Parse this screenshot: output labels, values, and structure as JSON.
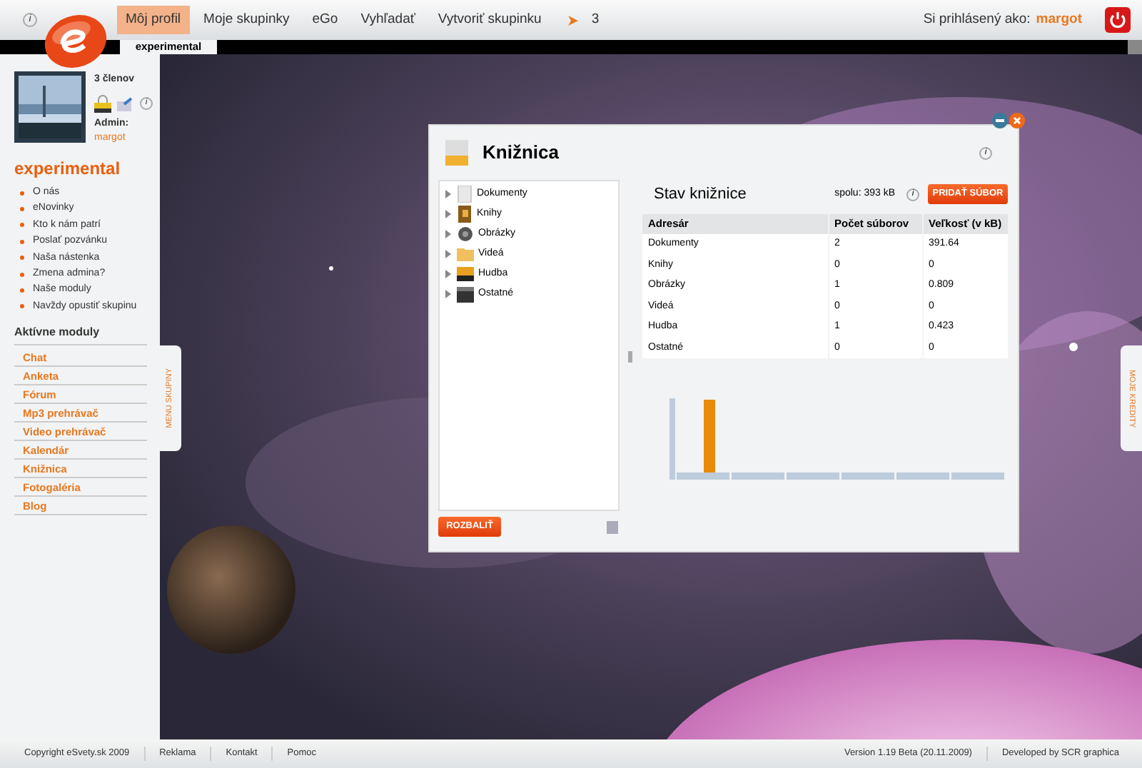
{
  "topbar": {
    "info": "i",
    "nav": [
      {
        "label": "Môj profil",
        "selected": true
      },
      {
        "label": "Moje skupinky",
        "selected": false
      },
      {
        "label": "eGo",
        "selected": false
      },
      {
        "label": "Vyhľadať",
        "selected": false
      },
      {
        "label": "Vytvoriť skupinku",
        "selected": false
      }
    ],
    "notifications": "3",
    "logged_label": "Si prihlásený ako:",
    "user": "margot"
  },
  "group_tab": "experimental",
  "sidebar": {
    "members": "3 členov",
    "info": "i",
    "admin_label": "Admin:",
    "admin": "margot",
    "title": "experimental",
    "links": [
      "O nás",
      "eNovinky",
      "Kto k nám patrí",
      "Poslať pozvánku",
      "Naša nástenka",
      "Zmena admina?",
      "Naše moduly",
      "Navždy opustiť skupinu"
    ],
    "modules_title": "Aktívne moduly",
    "modules": [
      "Chat",
      "Anketa",
      "Fórum",
      "Mp3 prehrávač",
      "Video prehrávač",
      "Kalendár",
      "Knižnica",
      "Fotogaléria",
      "Blog"
    ]
  },
  "left_tab": "MENU SKUPINY",
  "right_tab": "MOJE KREDITY",
  "dialog": {
    "title": "Knižnica",
    "info": "i",
    "tree": [
      {
        "label": "Dokumenty",
        "kind": "doc"
      },
      {
        "label": "Knihy",
        "kind": "book"
      },
      {
        "label": "Obrázky"
      },
      {
        "label": "Videá",
        "kind": "folder"
      },
      {
        "label": "Hudba",
        "kind": "music"
      },
      {
        "label": "Ostatné",
        "kind": "film"
      }
    ],
    "expand_button": "ROZBALIŤ",
    "status_title": "Stav knižnice",
    "total": "spolu: 393 kB",
    "info2": "i",
    "add_button": "PRIDAŤ SÚBOR",
    "table": {
      "columns": [
        "Adresár",
        "Počet súborov",
        "Veľkosť (v kB)"
      ],
      "rows": [
        [
          "Dokumenty",
          "2",
          "391.64"
        ],
        [
          "Knihy",
          "0",
          "0"
        ],
        [
          "Obrázky",
          "1",
          "0.809"
        ],
        [
          "Videá",
          "0",
          "0"
        ],
        [
          "Hudba",
          "1",
          "0.423"
        ],
        [
          "Ostatné",
          "0",
          "0"
        ]
      ]
    }
  },
  "footer": {
    "left": [
      "Copyright eSvety.sk 2009",
      "Reklama",
      "Kontakt",
      "Pomoc"
    ],
    "version": "Version 1.19 Beta (20.11.2009)",
    "developer": "Developed by SCR graphica"
  }
}
